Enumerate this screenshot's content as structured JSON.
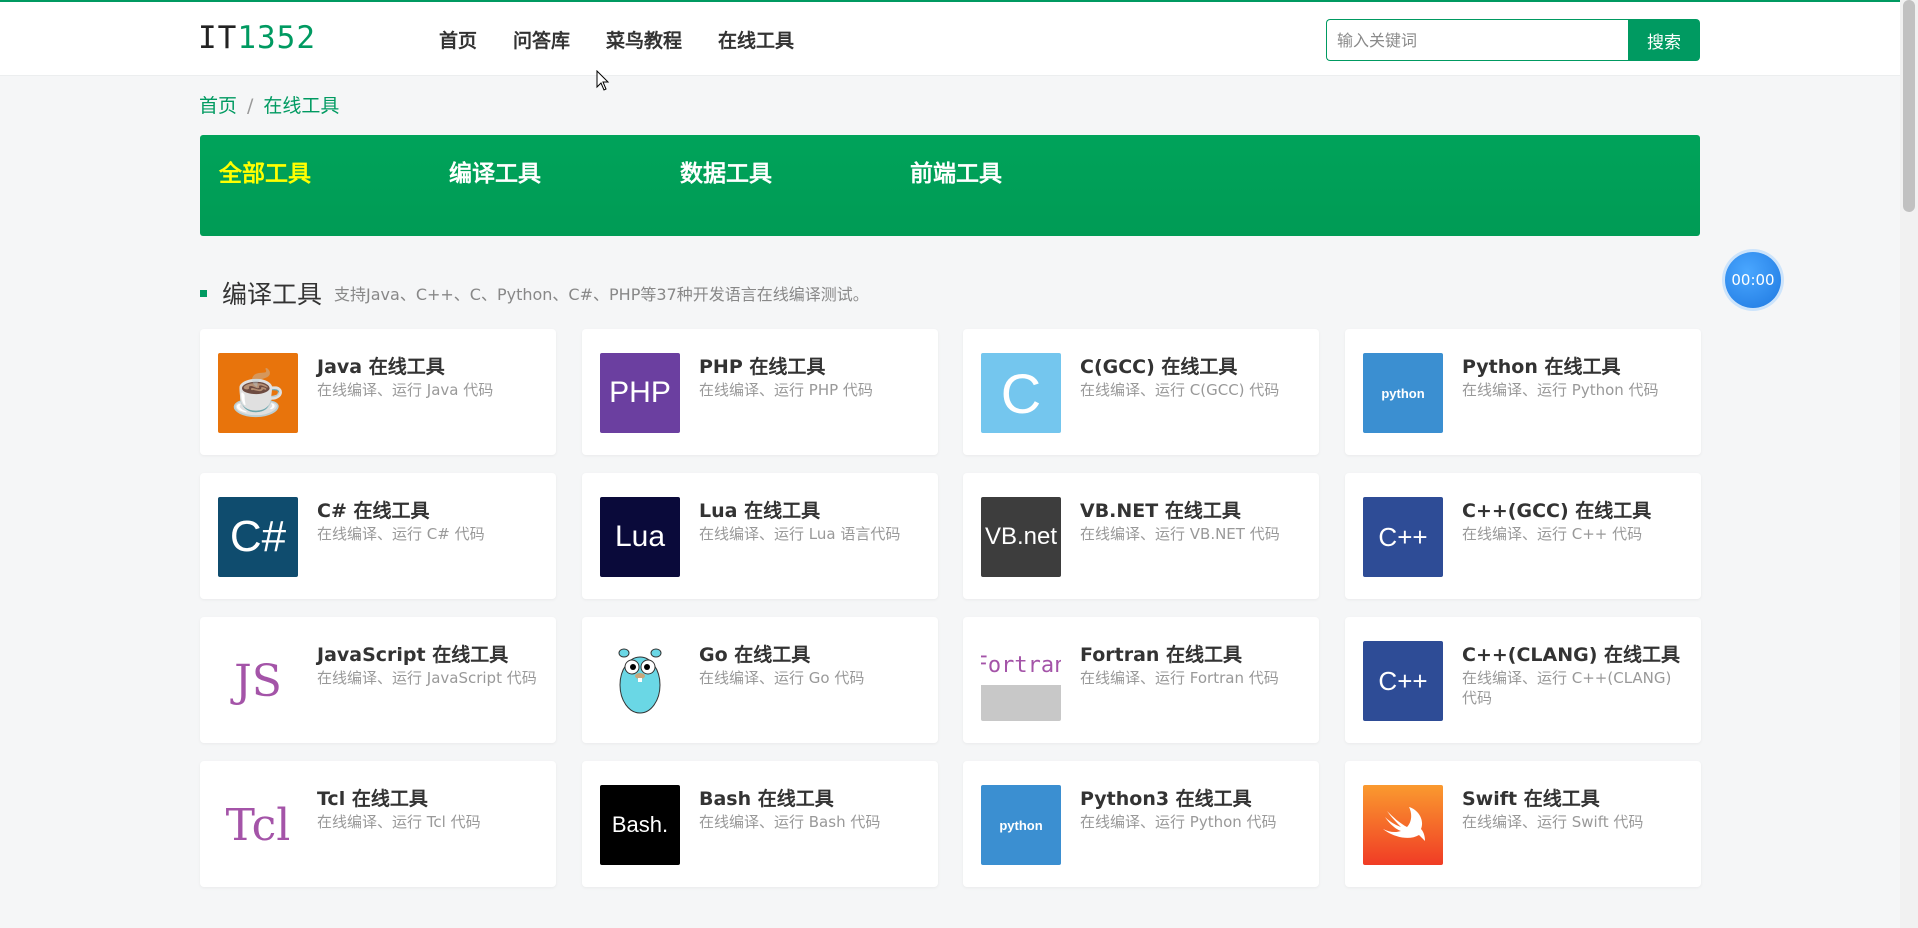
{
  "logo": {
    "part1": "IT",
    "part2": "1352"
  },
  "nav": [
    "首页",
    "问答库",
    "菜鸟教程",
    "在线工具"
  ],
  "search": {
    "placeholder": "输入关键词",
    "button": "搜索"
  },
  "breadcrumb": {
    "home": "首页",
    "sep": "/",
    "current": "在线工具"
  },
  "categories": [
    "全部工具",
    "编译工具",
    "数据工具",
    "前端工具"
  ],
  "section": {
    "title": "编译工具",
    "desc": "支持Java、C++、C、Python、C#、PHP等37种开发语言在线编译测试。"
  },
  "timer": "00:00",
  "tools": [
    {
      "title": "Java 在线工具",
      "desc": "在线编译、运行 Java 代码",
      "icon": "java-icon",
      "text": "☕",
      "bg": "#e8740c",
      "fg": "#ffffff"
    },
    {
      "title": "PHP 在线工具",
      "desc": "在线编译、运行 PHP 代码",
      "icon": "php-icon",
      "text": "PHP",
      "bg": "#6b3fa0",
      "fg": "#ffffff"
    },
    {
      "title": "C(GCC) 在线工具",
      "desc": "在线编译、运行 C(GCC) 代码",
      "icon": "c-icon",
      "text": "C",
      "bg": "#74c6ee",
      "fg": "#ffffff"
    },
    {
      "title": "Python 在线工具",
      "desc": "在线编译、运行 Python 代码",
      "icon": "python-icon",
      "text": "python",
      "bg": "#3b8fd1",
      "fg": "#ffffff"
    },
    {
      "title": "C# 在线工具",
      "desc": "在线编译、运行 C# 代码",
      "icon": "csharp-icon",
      "text": "C#",
      "bg": "#0f4c6e",
      "fg": "#ffffff"
    },
    {
      "title": "Lua 在线工具",
      "desc": "在线编译、运行 Lua 语言代码",
      "icon": "lua-icon",
      "text": "Lua",
      "bg": "#0a0a3a",
      "fg": "#ffffff"
    },
    {
      "title": "VB.NET 在线工具",
      "desc": "在线编译、运行 VB.NET 代码",
      "icon": "vbnet-icon",
      "text": "VB.net",
      "bg": "#3d3d3d",
      "fg": "#ffffff"
    },
    {
      "title": "C++(GCC) 在线工具",
      "desc": "在线编译、运行 C++ 代码",
      "icon": "cpp-icon",
      "text": "C++",
      "bg": "#2e4c96",
      "fg": "#ffffff"
    },
    {
      "title": "JavaScript 在线工具",
      "desc": "在线编译、运行 JavaScript 代码",
      "icon": "javascript-icon",
      "text": "JS",
      "bg": "#ffffff",
      "fg": "#a454a8"
    },
    {
      "title": "Go 在线工具",
      "desc": "在线编译、运行 Go 代码",
      "icon": "go-gopher-icon",
      "text": "",
      "bg": "#ffffff",
      "fg": "#5ec4e0"
    },
    {
      "title": "Fortran 在线工具",
      "desc": "在线编译、运行 Fortran 代码",
      "icon": "fortran-icon",
      "text": "Fortran",
      "bg": "#ffffff",
      "fg": "#a454a8"
    },
    {
      "title": "C++(CLANG) 在线工具",
      "desc": "在线编译、运行 C++(CLANG) 代码",
      "icon": "cpp-clang-icon",
      "text": "C++",
      "bg": "#2e4c96",
      "fg": "#ffffff"
    },
    {
      "title": "Tcl 在线工具",
      "desc": "在线编译、运行 Tcl 代码",
      "icon": "tcl-icon",
      "text": "Tcl",
      "bg": "#ffffff",
      "fg": "#a454a8"
    },
    {
      "title": "Bash 在线工具",
      "desc": "在线编译、运行 Bash 代码",
      "icon": "bash-icon",
      "text": "Bash.",
      "bg": "#000000",
      "fg": "#ffffff"
    },
    {
      "title": "Python3 在线工具",
      "desc": "在线编译、运行 Python 代码",
      "icon": "python3-icon",
      "text": "python",
      "bg": "#3b8fd1",
      "fg": "#ffffff"
    },
    {
      "title": "Swift 在线工具",
      "desc": "在线编译、运行 Swift 代码",
      "icon": "swift-icon",
      "text": "",
      "bg": "#f05a2a",
      "fg": "#ffffff"
    }
  ]
}
